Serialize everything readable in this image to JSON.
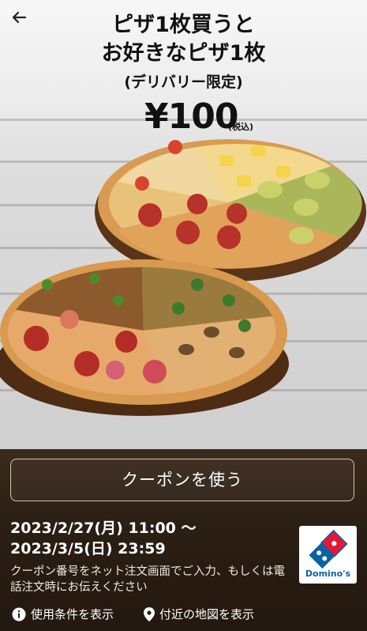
{
  "promo": {
    "headline_line1": "ピザ1枚買うと",
    "headline_line2": "お好きなピザ1枚",
    "subheadline": "(デリバリー限定)",
    "price": "¥100",
    "tax_note": "(税込)"
  },
  "actions": {
    "use_coupon_label": "クーポンを使う",
    "terms_link_label": "使用条件を表示",
    "map_link_label": "付近の地図を表示"
  },
  "validity": {
    "start": "2023/2/27(月) 11:00 〜",
    "end": "2023/3/5(日) 23:59"
  },
  "instructions": "クーポン番号をネット注文画面でご入力、もしくは電話注文時にお伝えください",
  "brand": {
    "name": "Domino's",
    "colors": {
      "blue": "#0a62a3",
      "red": "#e31837"
    }
  },
  "icons": {
    "back": "back-arrow-icon",
    "info": "info-icon",
    "location": "location-pin-icon"
  }
}
